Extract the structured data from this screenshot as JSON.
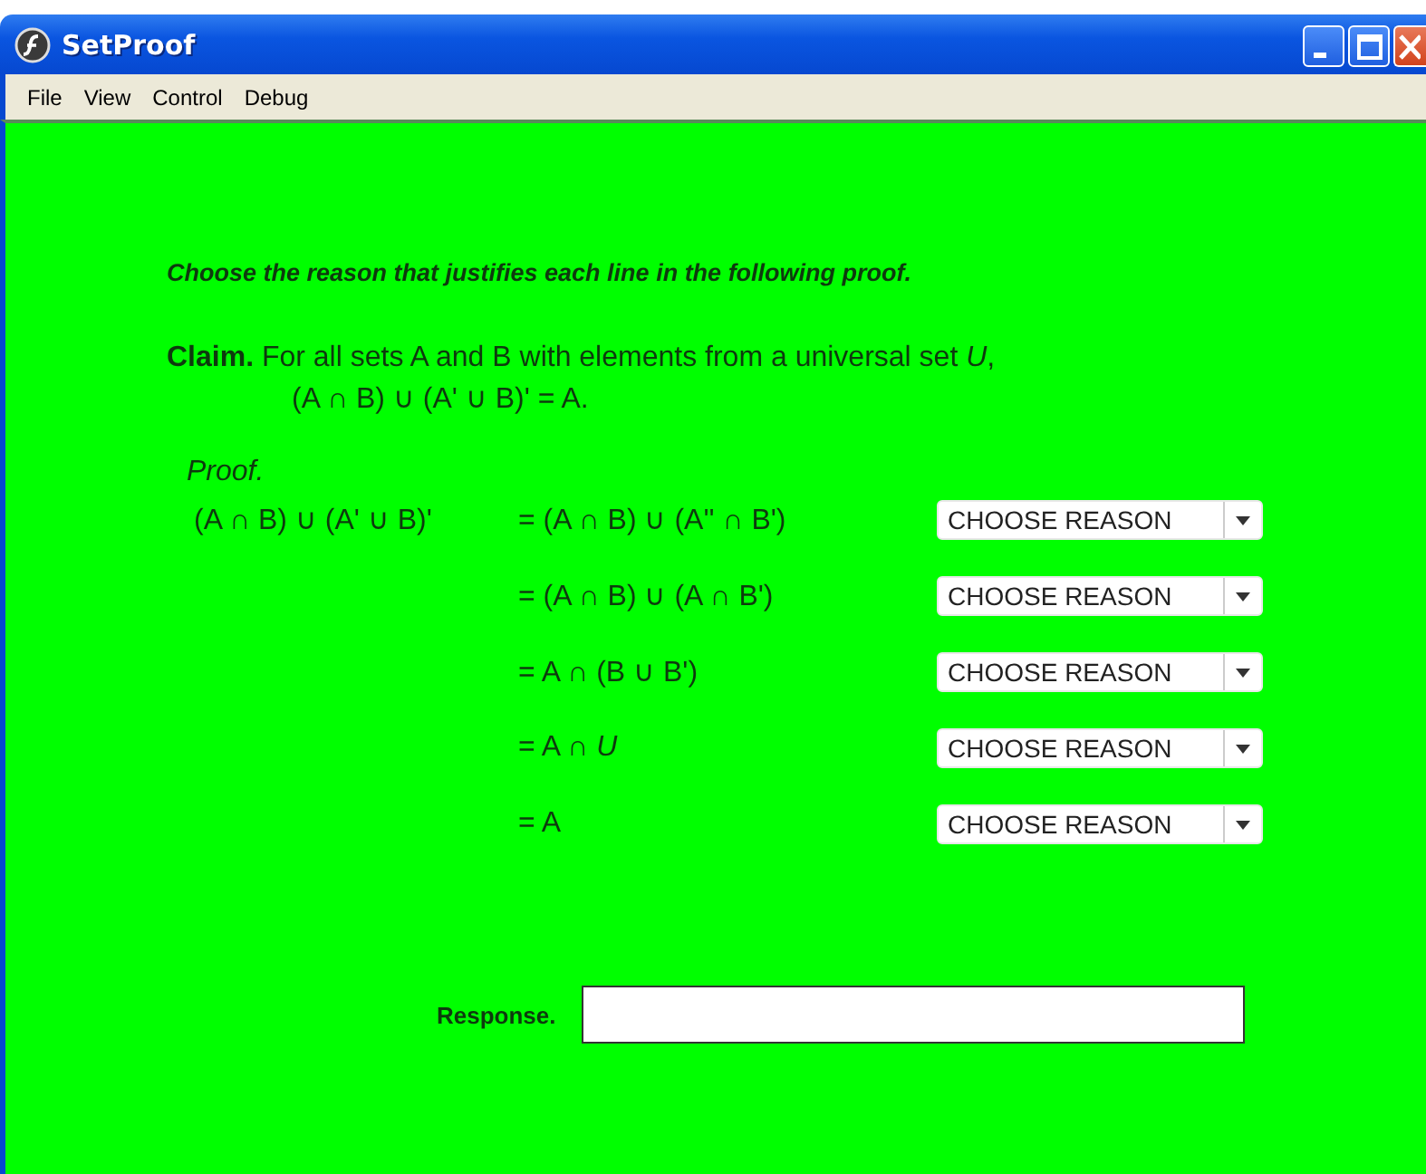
{
  "window": {
    "title": "SetProof"
  },
  "menu": [
    "File",
    "View",
    "Control",
    "Debug"
  ],
  "instruction": "Choose the reason that justifies each line in the following proof.",
  "claim": {
    "line_1": "**Claim.** For all sets A and B with elements from a universal set *U*,",
    "line_2": "(A ∩ B) ∪ (A' ∪ B)' = A."
  },
  "proof_label": "Proof.",
  "proof_lines": [
    {
      "lhs": "(A ∩ B) ∪ (A' ∪ B)'",
      "rhs": "= (A ∩ B) ∪ (A'' ∩ B')",
      "reason": "CHOOSE REASON"
    },
    {
      "rhs": "= (A ∩ B) ∪ (A ∩ B')",
      "reason": "CHOOSE REASON"
    },
    {
      "rhs": "= A ∩ (B ∪ B')",
      "reason": "CHOOSE REASON"
    },
    {
      "rhs": "= A ∩ *U*",
      "reason": "CHOOSE REASON"
    },
    {
      "rhs": "= A",
      "reason": "CHOOSE REASON"
    }
  ],
  "response": {
    "label": "Response."
  }
}
